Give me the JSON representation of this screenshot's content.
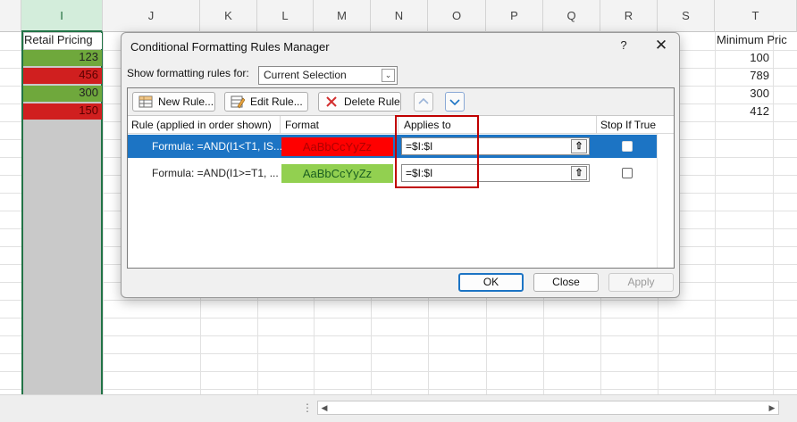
{
  "sheet": {
    "columns": [
      "I",
      "J",
      "K",
      "L",
      "M",
      "N",
      "O",
      "P",
      "Q",
      "R",
      "S",
      "T"
    ],
    "selected_column": "I",
    "header_i": "Retail Pricing",
    "values_i": [
      "123",
      "456",
      "300",
      "150"
    ],
    "fills_i": [
      "#6fa83c",
      "#d01f1f",
      "#6fa83c",
      "#d01f1f"
    ],
    "header_t": "Minimum Pric",
    "values_t": [
      "100",
      "789",
      "300",
      "412"
    ]
  },
  "dialog": {
    "title": "Conditional Formatting Rules Manager",
    "help": "?",
    "close": "✕",
    "show_rules_label": "Show formatting rules for:",
    "show_rules_value": "Current Selection",
    "new_rule": "New Rule...",
    "edit_rule": "Edit Rule...",
    "delete_rule": "Delete Rule",
    "columns": {
      "rule": "Rule (applied in order shown)",
      "format": "Format",
      "applies_to": "Applies to",
      "stop_if_true": "Stop If True"
    },
    "rules": [
      {
        "rule": "Formula: =AND(I1<T1, IS...",
        "format_preview": "AaBbCcYyZz",
        "format_color": "#ff0000",
        "applies_to": "=$I:$I",
        "stop_if_true": false,
        "selected": true
      },
      {
        "rule": "Formula: =AND(I1>=T1, ...",
        "format_preview": "AaBbCcYyZz",
        "format_color": "#92d050",
        "applies_to": "=$I:$I",
        "stop_if_true": false,
        "selected": false
      }
    ],
    "ok": "OK",
    "close_btn": "Close",
    "apply": "Apply"
  },
  "colors": {
    "selection_blue": "#1c74c4",
    "highlight_red": "#c00000",
    "excel_green": "#217346"
  }
}
